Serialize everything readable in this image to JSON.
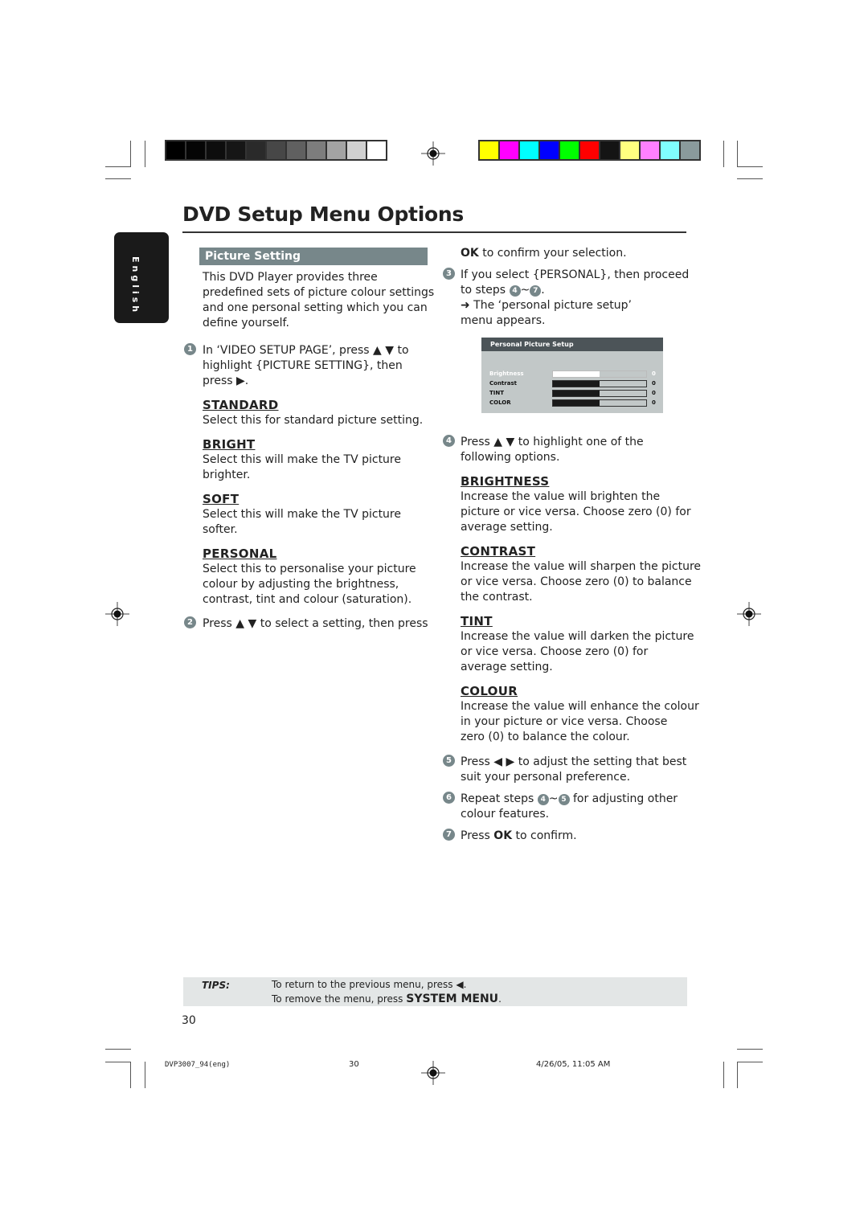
{
  "colors": {
    "grayscale_strip": [
      "#000000",
      "#050505",
      "#0d0d0d",
      "#161616",
      "#2a2a2a",
      "#474747",
      "#606060",
      "#7d7d7d",
      "#a3a3a3",
      "#d0d0d0",
      "#ffffff"
    ],
    "color_strip": [
      "#ffff00",
      "#ff00ff",
      "#00ffff",
      "#0000ff",
      "#00ff00",
      "#ff0000",
      "#141414",
      "#ffff80",
      "#ff80ff",
      "#80ffff",
      "#8a9a9c"
    ],
    "accent": "#77878a"
  },
  "header": {
    "title": "DVD Setup Menu Options",
    "language_tab": "English"
  },
  "left": {
    "section_title": "Picture Setting",
    "intro": [
      "This DVD Player provides three",
      "predefined sets of picture colour settings",
      "and one personal setting which you can",
      "define yourself."
    ],
    "step1": {
      "num": "1",
      "lines": [
        "In ‘VIDEO SETUP PAGE’, press ▲ ▼ to",
        "highlight {PICTURE SETTING}, then",
        "press ▶."
      ]
    },
    "options": [
      {
        "title": "STANDARD",
        "lines": [
          "Select this for standard picture setting."
        ]
      },
      {
        "title": "BRIGHT",
        "lines": [
          "Select this will make the TV picture",
          "brighter."
        ]
      },
      {
        "title": "SOFT",
        "lines": [
          "Select this will make the TV picture",
          "softer."
        ]
      },
      {
        "title": "PERSONAL",
        "lines": [
          "Select this to personalise your picture",
          "colour by adjusting the brightness,",
          "contrast, tint and colour (saturation)."
        ]
      }
    ],
    "step2": {
      "num": "2",
      "text": "Press ▲ ▼ to select a setting, then press"
    }
  },
  "right": {
    "continue_ok": "OK",
    "continue_text": " to confirm your selection.",
    "step3": {
      "num": "3",
      "line1": "If you select {PERSONAL}, then proceed",
      "line2_pre": "to steps ",
      "ref_a": "4",
      "tilde": "~",
      "ref_b": "7",
      "line2_post": ".",
      "line3": "➜ The ‘personal picture setup’",
      "line4": "menu appears."
    },
    "osd": {
      "title": "Personal Picture Setup",
      "rows": [
        {
          "label": "Brightness",
          "value": "0",
          "level": 0.5,
          "selected": true
        },
        {
          "label": "Contrast",
          "value": "0",
          "level": 0.5,
          "selected": false
        },
        {
          "label": "TINT",
          "value": "0",
          "level": 0.5,
          "selected": false
        },
        {
          "label": "COLOR",
          "value": "0",
          "level": 0.5,
          "selected": false
        }
      ]
    },
    "step4": {
      "num": "4",
      "lines": [
        "Press ▲ ▼ to highlight one of the",
        "following options."
      ]
    },
    "options": [
      {
        "title": "BRIGHTNESS",
        "lines": [
          "Increase the value will brighten the",
          "picture or vice versa. Choose zero (0) for",
          "average setting."
        ]
      },
      {
        "title": "CONTRAST",
        "lines": [
          "Increase the value will sharpen the picture",
          "or vice versa.  Choose zero (0) to balance",
          "the contrast."
        ]
      },
      {
        "title": "TINT",
        "lines": [
          "Increase the value will darken the picture",
          "or vice versa.  Choose zero (0) for",
          "average setting."
        ]
      },
      {
        "title": "COLOUR",
        "lines": [
          "Increase the value will enhance the colour",
          "in your picture or vice versa. Choose",
          "zero (0) to balance the colour."
        ]
      }
    ],
    "step5": {
      "num": "5",
      "lines": [
        "Press ◀ ▶ to adjust the setting that best",
        "suit your personal preference."
      ]
    },
    "step6": {
      "num": "6",
      "pre": "Repeat steps ",
      "ref_a": "4",
      "tilde": "~",
      "ref_b": "5",
      "post": " for adjusting other",
      "line2": "colour features."
    },
    "step7": {
      "num": "7",
      "pre": "Press ",
      "ok": "OK",
      "post": " to confirm."
    }
  },
  "tips": {
    "label": "TIPS:",
    "line1": "To return to the previous menu, press ◀.",
    "line2_pre": "To remove the menu, press ",
    "line2_bold": "SYSTEM MENU",
    "line2_post": "."
  },
  "page_number": "30",
  "footer": {
    "file": "DVP3007_94(eng)",
    "page": "30",
    "timestamp": "4/26/05, 11:05 AM"
  }
}
